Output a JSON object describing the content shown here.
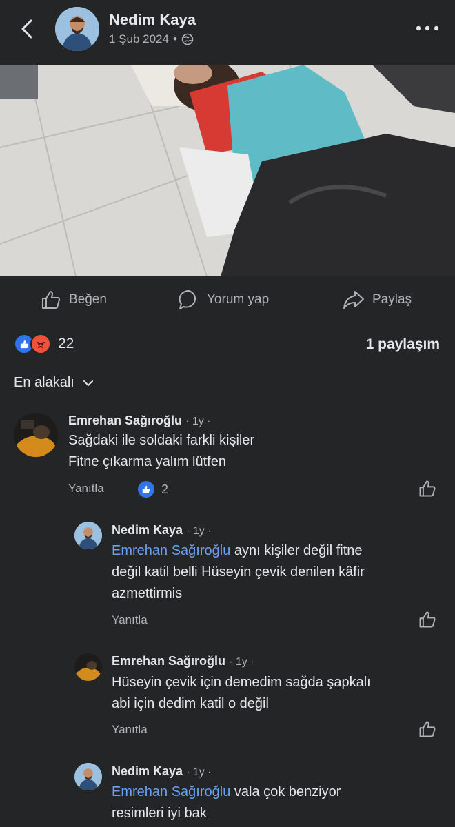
{
  "header": {
    "author": "Nedim Kaya",
    "date": "1 Şub 2024",
    "separator": "•",
    "privacy_icon": "globe-icon"
  },
  "actions": {
    "like": "Beğen",
    "comment": "Yorum yap",
    "share": "Paylaş"
  },
  "stats": {
    "reaction_count": "22",
    "shares": "1 paylaşım",
    "reaction_icons": [
      "like-reaction-icon",
      "angry-reaction-icon"
    ]
  },
  "sort": {
    "label": "En alakalı"
  },
  "comments": [
    {
      "author": "Emrehan Sağıroğlu",
      "time": "· 1y ·",
      "line1": "Sağdaki ile soldaki farkli kişiler",
      "line2": "Fitne çıkarma yalım lütfen",
      "reply": "Yanıtla",
      "likes": "2"
    },
    {
      "author": "Nedim Kaya",
      "time": "· 1y ·",
      "mention": "Emrehan Sağıroğlu",
      "line1": " aynı kişiler değil fitne",
      "line2": "değil katil belli Hüseyin çevik denilen kâfir",
      "line3": "azmettirmis",
      "reply": "Yanıtla"
    },
    {
      "author": "Emrehan Sağıroğlu",
      "time": "· 1y ·",
      "line1": "Hüseyin çevik için demedim sağda şapkalı",
      "line2": "abi için dedim katil o değil",
      "reply": "Yanıtla"
    },
    {
      "author": "Nedim Kaya",
      "time": "· 1y ·",
      "mention": "Emrehan Sağıroğlu",
      "line1": " vala çok benziyor",
      "line2": "resimleri iyi bak"
    }
  ],
  "colors": {
    "background": "#242526",
    "text": "#e4e6eb",
    "secondary": "#b0b3b8",
    "mention": "#6aa0ef",
    "like_blue": "#2f74e8",
    "angry_orange": "#f0513a"
  }
}
